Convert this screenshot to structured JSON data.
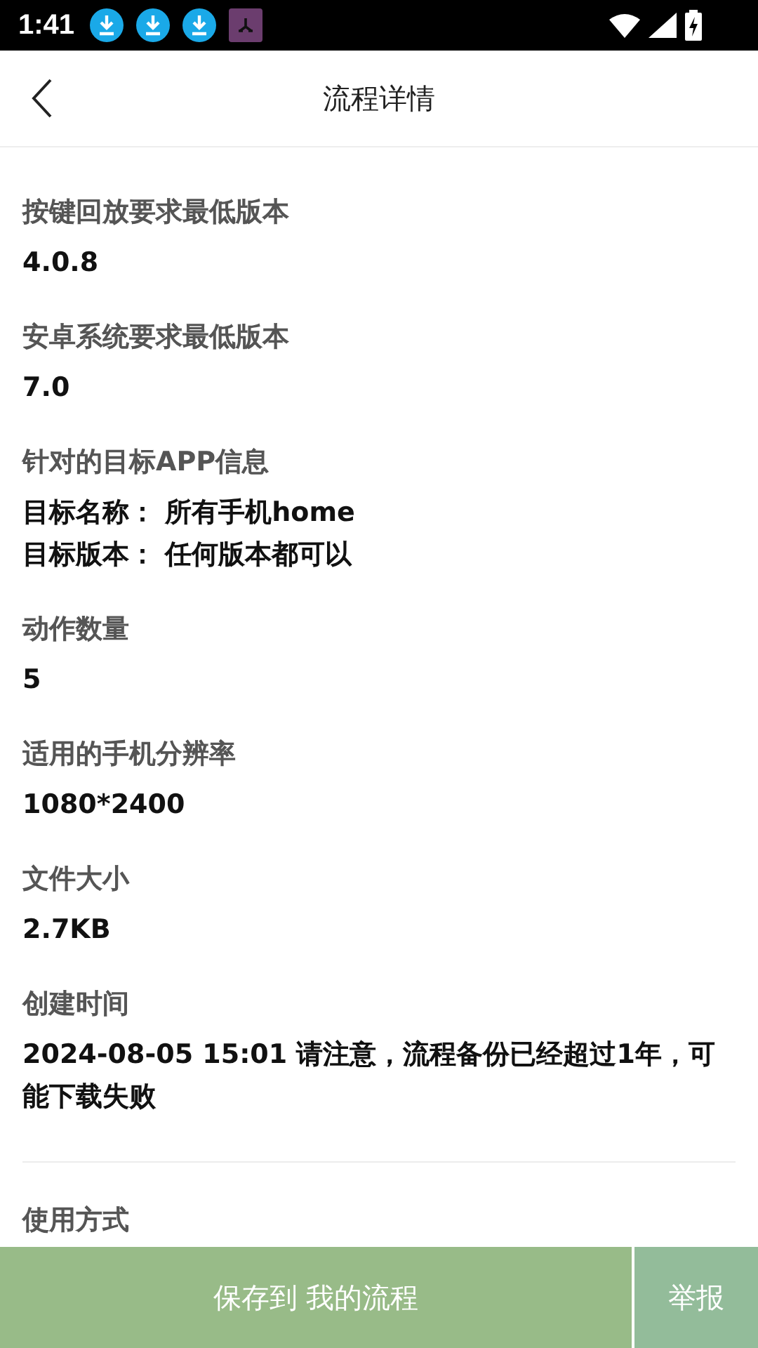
{
  "status_bar": {
    "time": "1:41"
  },
  "header": {
    "title": "流程详情"
  },
  "sections": [
    {
      "label": "按键回放要求最低版本",
      "values": [
        "4.0.8"
      ]
    },
    {
      "label": "安卓系统要求最低版本",
      "values": [
        "7.0"
      ]
    },
    {
      "label": "针对的目标APP信息",
      "values": [
        "目标名称：  所有手机home",
        "目标版本：  任何版本都可以"
      ]
    },
    {
      "label": "动作数量",
      "values": [
        "5"
      ]
    },
    {
      "label": "适用的手机分辨率",
      "values": [
        "1080*2400"
      ]
    },
    {
      "label": "文件大小",
      "values": [
        "2.7KB"
      ]
    },
    {
      "label": "创建时间",
      "values": [
        "2024-08-05 15:01  请注意，流程备份已经超过1年，可能下载失败"
      ]
    }
  ],
  "usage": {
    "label": "使用方式"
  },
  "bottom_bar": {
    "save_button": "保存到 我的流程",
    "report_button": "举报"
  }
}
